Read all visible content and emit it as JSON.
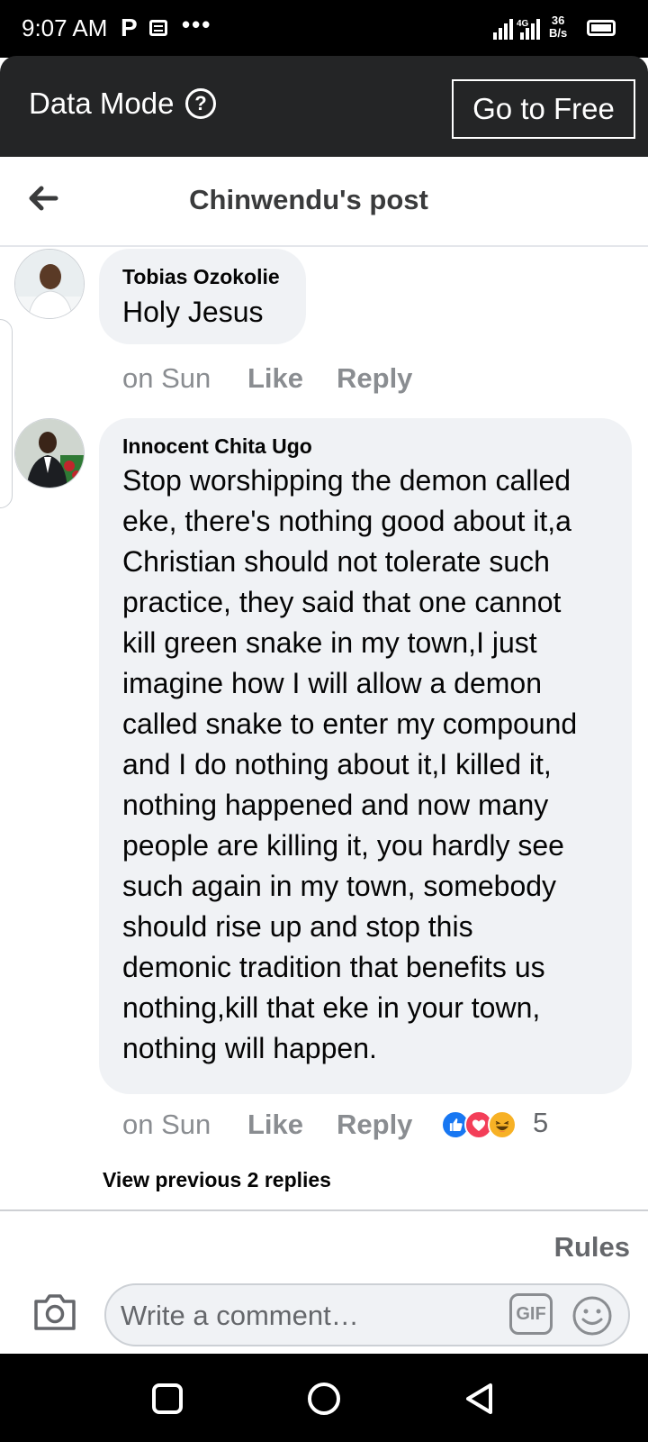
{
  "status_bar": {
    "time": "9:07 AM",
    "notification_p": "P",
    "overflow_dots": "•••",
    "network_type": "4G",
    "net_speed_value": "36",
    "net_speed_unit": "B/s",
    "battery_level": 1.0
  },
  "data_bar": {
    "label": "Data Mode",
    "help_icon": "question-circle-icon",
    "help_symbol": "?",
    "go_free_label": "Go to Free"
  },
  "header": {
    "back_icon": "arrow-left-icon",
    "title": "Chinwendu's post"
  },
  "comments": [
    {
      "author": "Tobias Ozokolie",
      "text": "Holy Jesus",
      "time": "on Sun",
      "like_label": "Like",
      "reply_label": "Reply"
    },
    {
      "author": "Innocent Chita Ugo",
      "lines": [
        "Stop worshipping the demon called",
        "eke, there's nothing good about it,a",
        "Christian should not tolerate such",
        "practice, they said that one cannot",
        "kill green snake in my town,I just",
        "imagine how I will allow a demon",
        "called snake to enter my compound",
        "and I do nothing about it,I killed it,",
        "nothing happened and now many",
        "people are killing it, you hardly see",
        "such again in my town, somebody",
        "should rise up and stop this",
        "demonic tradition that benefits us",
        "nothing,kill that eke in your town,",
        "nothing will happen."
      ],
      "time": "on Sun",
      "like_label": "Like",
      "reply_label": "Reply",
      "reactions": [
        "like",
        "love",
        "haha"
      ],
      "reaction_count": "5"
    }
  ],
  "view_previous_replies": "View previous 2 replies",
  "composer": {
    "rules_label": "Rules",
    "placeholder": "Write a comment…",
    "gif_label": "GIF",
    "camera_icon": "camera-icon",
    "emoji_icon": "smiley-icon"
  },
  "nav_bar": {
    "recents_icon": "square-icon",
    "home_icon": "circle-icon",
    "back_icon": "triangle-back-icon"
  },
  "colors": {
    "data_bar_bg": "#242526",
    "bubble_bg": "#f0f2f5",
    "meta_text": "#8a8d91",
    "like_blue": "#1877f2",
    "love_red": "#f33e58",
    "haha_yellow": "#f7b125"
  }
}
